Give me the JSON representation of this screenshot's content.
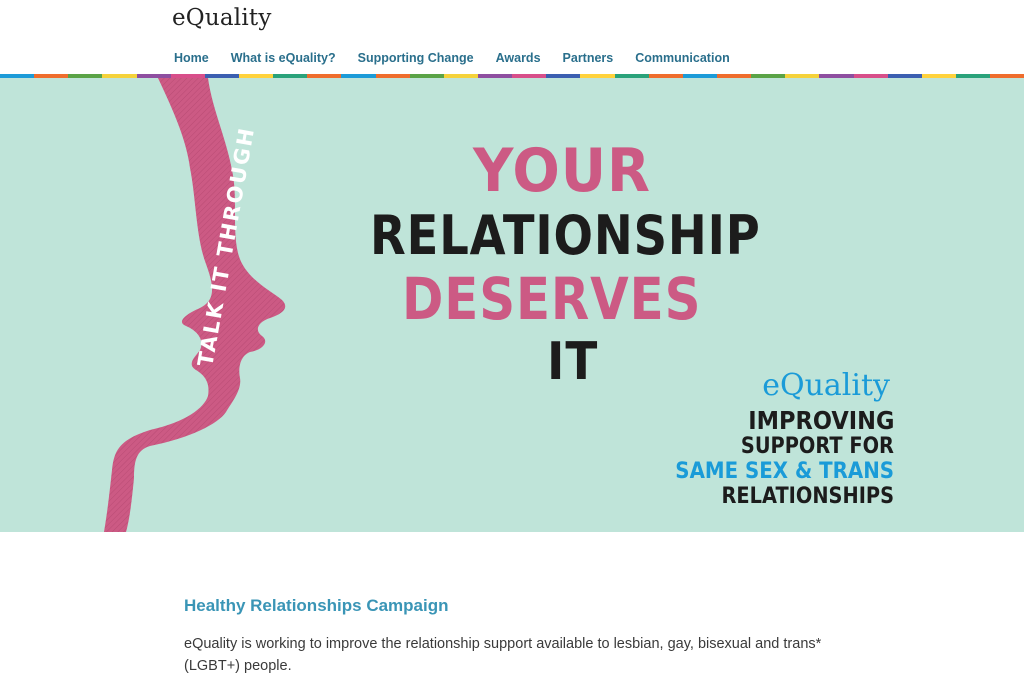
{
  "header": {
    "logo": "eQuality",
    "nav": [
      "Home",
      "What is eQuality?",
      "Supporting Change",
      "Awards",
      "Partners",
      "Communication"
    ]
  },
  "stripe_colors": [
    "#1c9bd8",
    "#ef6d2d",
    "#5aa346",
    "#f5d23a",
    "#8e4fa0",
    "#d84f8a",
    "#3b5fb0",
    "#ffd23c",
    "#2aa27a",
    "#ef6d2d"
  ],
  "hero": {
    "ribbon_text": "TALK IT THROUGH",
    "headline": [
      "YOUR",
      "RELATIONSHIP",
      "DESERVES",
      "IT"
    ],
    "brand": "eQuality",
    "tagline": [
      "IMPROVING",
      "SUPPORT FOR",
      "SAME SEX & TRANS",
      "RELATIONSHIPS"
    ],
    "colors": {
      "background": "#bfe4d9",
      "pink": "#cc5a84",
      "dark": "#1c1c1c",
      "blue": "#1a9bd8"
    }
  },
  "content": {
    "heading": "Healthy Relationships Campaign",
    "paragraph": "eQuality is working to improve the relationship support available to lesbian, gay, bisexual and trans* (LGBT+) people."
  }
}
